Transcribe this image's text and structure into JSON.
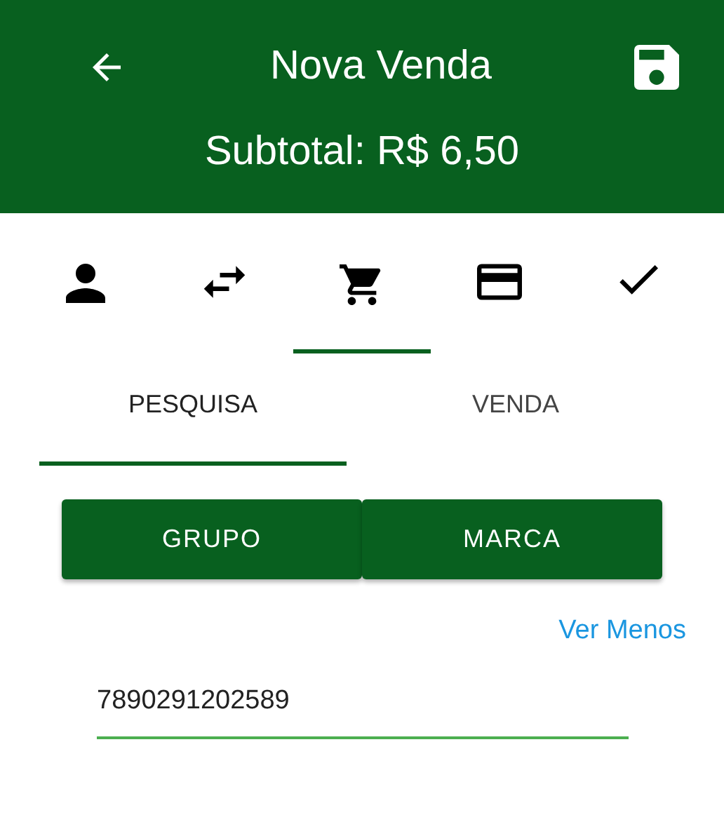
{
  "app_bar": {
    "title": "Nova Venda",
    "subtitle": "Subtotal: R$ 6,50"
  },
  "steps": [
    {
      "kind": "person",
      "selected": false
    },
    {
      "kind": "swap",
      "selected": false
    },
    {
      "kind": "cart",
      "selected": true
    },
    {
      "kind": "card",
      "selected": false
    },
    {
      "kind": "check",
      "selected": false
    }
  ],
  "tabs": [
    {
      "label": "PESQUISA",
      "selected": true
    },
    {
      "label": "VENDA",
      "selected": false
    }
  ],
  "buttons": [
    "GRUPO",
    "MARCA"
  ],
  "toggle_link": "Ver Menos",
  "search": {
    "value": "7890291202589"
  }
}
